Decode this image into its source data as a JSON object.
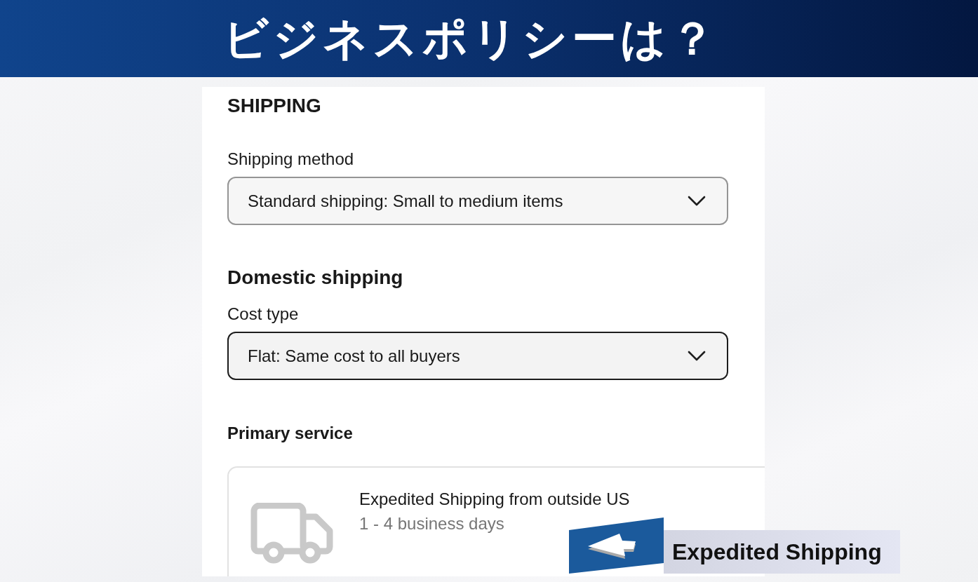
{
  "banner": {
    "title": "ビジネスポリシーは？"
  },
  "shipping": {
    "title": "SHIPPING",
    "shipping_method": {
      "label": "Shipping method",
      "value": "Standard shipping: Small to medium items",
      "focused": false
    },
    "domestic_shipping": {
      "title": "Domestic shipping",
      "cost_type": {
        "label": "Cost type",
        "value": "Flat: Same cost to all buyers",
        "focused": true
      },
      "primary_service": {
        "title": "Primary service",
        "service": {
          "name": "Expedited Shipping from outside US",
          "delivery_time": "1 - 4 business days"
        }
      }
    }
  },
  "callout": {
    "text": "Expedited Shipping"
  }
}
